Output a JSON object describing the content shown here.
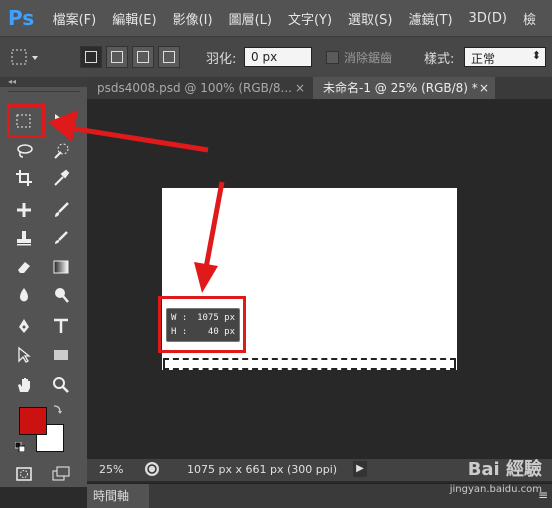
{
  "app": {
    "logo": "Ps"
  },
  "menu": [
    "檔案(F)",
    "編輯(E)",
    "影像(I)",
    "圖層(L)",
    "文字(Y)",
    "選取(S)",
    "濾鏡(T)",
    "3D(D)",
    "檢"
  ],
  "options": {
    "feather_label": "羽化:",
    "feather_value": "0 px",
    "antialias_label": "消除鋸齒",
    "style_label": "樣式:",
    "style_value": "正常",
    "style_arrow": "⬍"
  },
  "tabs": [
    {
      "label": "psds4008.psd @ 100% (RGB/8...",
      "close": "×",
      "active": false
    },
    {
      "label": "未命名-1 @ 25% (RGB/8) *",
      "close": "×",
      "active": true
    }
  ],
  "toolbox": {
    "header": "◂◂",
    "foreground_color": "#cc1111",
    "background_color": "#ffffff"
  },
  "readout": {
    "w_label": "W :",
    "w_value": "1075 px",
    "h_label": "H :",
    "h_value": "40 px"
  },
  "status": {
    "zoom": "25%",
    "doc_info": "1075 px x 661 px (300 ppi)",
    "arrow": "▶"
  },
  "timeline": {
    "label": "時間軸",
    "menu": "≡"
  },
  "watermark": {
    "brand": "Bai 經驗",
    "url": "jingyan.baidu.com"
  },
  "colors": {
    "annotation": "#e01a1a",
    "accent": "#3fa0ff"
  }
}
